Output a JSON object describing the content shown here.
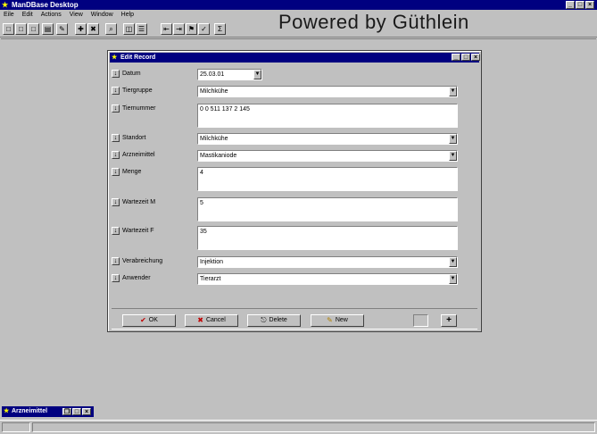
{
  "app": {
    "title": "ManDBase Desktop",
    "powered_by": "Powered by Güthlein",
    "window_buttons": [
      "_",
      "□",
      "×"
    ]
  },
  "menubar": [
    "Eile",
    "Edit",
    "Actions",
    "View",
    "Window",
    "Help"
  ],
  "toolbar": {
    "icons": [
      "new-icon",
      "open-icon",
      "print-icon",
      "copy-icon",
      "edit-icon",
      "add-record-icon",
      "delete-record-icon",
      "find-icon",
      "view-icon",
      "list-icon",
      "import-icon",
      "export-icon",
      "filter-icon",
      "report-icon",
      "sum-icon"
    ],
    "glyphs": [
      "□",
      "□",
      "□",
      "▤",
      "✎",
      "✚",
      "✖",
      "⌕",
      "◫",
      "☰",
      "⇤",
      "⇥",
      "⚑",
      "✓",
      "Σ"
    ]
  },
  "edit_window": {
    "title": "Edit Record",
    "fields": [
      {
        "label": "Datum",
        "value": "25.03.01",
        "type": "dropdown"
      },
      {
        "label": "Tiergruppe",
        "value": "Milchkühe",
        "type": "dropdown"
      },
      {
        "label": "Tiernummer",
        "value": "0 0 511 137 2 145",
        "type": "textarea"
      },
      {
        "label": "Standort",
        "value": "Milchkühe",
        "type": "dropdown"
      },
      {
        "label": "Arzneimittel",
        "value": "Mastikaniode",
        "type": "dropdown"
      },
      {
        "label": "Menge",
        "value": "4",
        "type": "textarea"
      },
      {
        "label": "Wartezeit M",
        "value": "5",
        "type": "textarea"
      },
      {
        "label": "Wartezeit F",
        "value": "35",
        "type": "textarea"
      },
      {
        "label": "Verabreichung",
        "value": "Injektion",
        "type": "dropdown"
      },
      {
        "label": "Anwender",
        "value": "Tierarzt",
        "type": "dropdown"
      }
    ],
    "buttons": {
      "ok": "OK",
      "cancel": "Cancel",
      "delete": "Delete",
      "new": "New",
      "plus": "+"
    }
  },
  "minimized": {
    "title": "Arzneimittel"
  },
  "colors": {
    "titlebar": "#000080",
    "face": "#c0c0c0"
  }
}
